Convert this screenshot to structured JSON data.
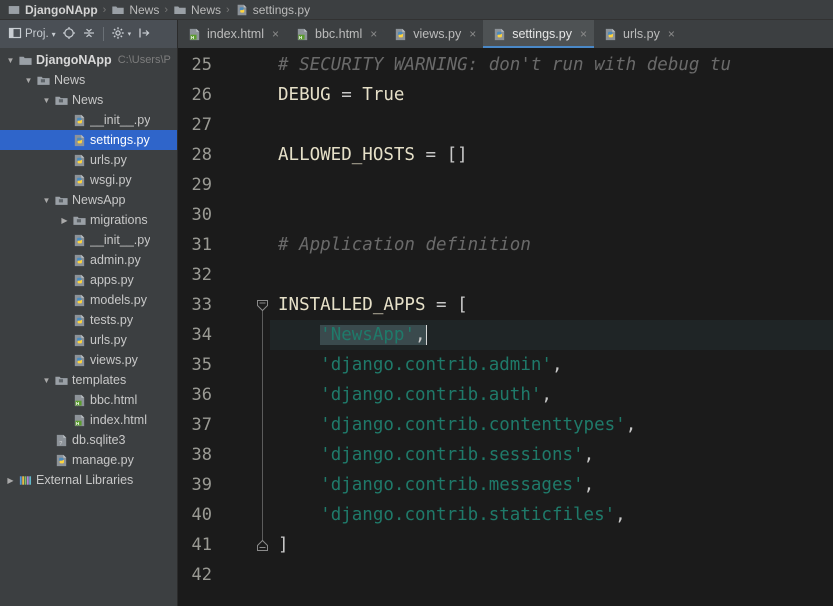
{
  "breadcrumb": {
    "items": [
      {
        "label": "DjangoNApp",
        "icon": "project-icon",
        "bold": true
      },
      {
        "label": "News",
        "icon": "folder-icon",
        "bold": false
      },
      {
        "label": "News",
        "icon": "folder-icon",
        "bold": false
      },
      {
        "label": "settings.py",
        "icon": "python-file-icon",
        "bold": false
      }
    ],
    "separator": "›"
  },
  "toolbar": {
    "project_label": "Proj.",
    "project_dropdown": "▾",
    "locate_icon": "target-icon",
    "collapse_icon": "collapse-all-icon",
    "settings_icon": "gear-icon",
    "settings_dropdown": "▾",
    "hide_icon": "hide-panel-icon"
  },
  "tabs": [
    {
      "label": "index.html",
      "icon": "html-file-icon",
      "active": false,
      "close": "×"
    },
    {
      "label": "bbc.html",
      "icon": "html-file-icon",
      "active": false,
      "close": "×"
    },
    {
      "label": "views.py",
      "icon": "python-file-icon",
      "active": false,
      "close": "×"
    },
    {
      "label": "settings.py",
      "icon": "python-file-icon",
      "active": true,
      "close": "×"
    },
    {
      "label": "urls.py",
      "icon": "python-file-icon",
      "active": false,
      "close": "×"
    }
  ],
  "tree": [
    {
      "label": "DjangoNApp",
      "path": "C:\\Users\\P",
      "indent": 0,
      "arrow": "down",
      "icon": "folder-icon",
      "bold": true,
      "selected": false
    },
    {
      "label": "News",
      "indent": 1,
      "arrow": "down",
      "icon": "module-folder-icon",
      "bold": false,
      "selected": false
    },
    {
      "label": "News",
      "indent": 2,
      "arrow": "down",
      "icon": "module-folder-icon",
      "bold": false,
      "selected": false
    },
    {
      "label": "__init__.py",
      "indent": 3,
      "arrow": "none",
      "icon": "python-file-icon",
      "bold": false,
      "selected": false
    },
    {
      "label": "settings.py",
      "indent": 3,
      "arrow": "none",
      "icon": "python-file-icon",
      "bold": false,
      "selected": true
    },
    {
      "label": "urls.py",
      "indent": 3,
      "arrow": "none",
      "icon": "python-file-icon",
      "bold": false,
      "selected": false
    },
    {
      "label": "wsgi.py",
      "indent": 3,
      "arrow": "none",
      "icon": "python-file-icon",
      "bold": false,
      "selected": false
    },
    {
      "label": "NewsApp",
      "indent": 2,
      "arrow": "down",
      "icon": "module-folder-icon",
      "bold": false,
      "selected": false
    },
    {
      "label": "migrations",
      "indent": 3,
      "arrow": "right",
      "icon": "module-folder-icon",
      "bold": false,
      "selected": false
    },
    {
      "label": "__init__.py",
      "indent": 3,
      "arrow": "none",
      "icon": "python-file-icon",
      "bold": false,
      "selected": false
    },
    {
      "label": "admin.py",
      "indent": 3,
      "arrow": "none",
      "icon": "python-file-icon",
      "bold": false,
      "selected": false
    },
    {
      "label": "apps.py",
      "indent": 3,
      "arrow": "none",
      "icon": "python-file-icon",
      "bold": false,
      "selected": false
    },
    {
      "label": "models.py",
      "indent": 3,
      "arrow": "none",
      "icon": "python-file-icon",
      "bold": false,
      "selected": false
    },
    {
      "label": "tests.py",
      "indent": 3,
      "arrow": "none",
      "icon": "python-file-icon",
      "bold": false,
      "selected": false
    },
    {
      "label": "urls.py",
      "indent": 3,
      "arrow": "none",
      "icon": "python-file-icon",
      "bold": false,
      "selected": false
    },
    {
      "label": "views.py",
      "indent": 3,
      "arrow": "none",
      "icon": "python-file-icon",
      "bold": false,
      "selected": false
    },
    {
      "label": "templates",
      "indent": 2,
      "arrow": "down",
      "icon": "module-folder-icon",
      "bold": false,
      "selected": false
    },
    {
      "label": "bbc.html",
      "indent": 3,
      "arrow": "none",
      "icon": "html-file-icon",
      "bold": false,
      "selected": false
    },
    {
      "label": "index.html",
      "indent": 3,
      "arrow": "none",
      "icon": "html-file-icon",
      "bold": false,
      "selected": false
    },
    {
      "label": "db.sqlite3",
      "indent": 2,
      "arrow": "none",
      "icon": "db-file-icon",
      "bold": false,
      "selected": false
    },
    {
      "label": "manage.py",
      "indent": 2,
      "arrow": "none",
      "icon": "python-file-icon",
      "bold": false,
      "selected": false
    },
    {
      "label": "External Libraries",
      "indent": 0,
      "arrow": "right",
      "icon": "libraries-icon",
      "bold": false,
      "selected": false
    }
  ],
  "editor": {
    "file": "settings.py",
    "first_visible_line": 25,
    "selected_line": 34,
    "lines": [
      {
        "num": 25,
        "tokens": [
          {
            "text": "# SECURITY WARNING: don't run with debug tu",
            "type": "comment"
          }
        ]
      },
      {
        "num": 26,
        "tokens": [
          {
            "text": "DEBUG",
            "type": "ident"
          },
          {
            "text": " = ",
            "type": "op"
          },
          {
            "text": "True",
            "type": "kw"
          }
        ]
      },
      {
        "num": 27,
        "tokens": []
      },
      {
        "num": 28,
        "tokens": [
          {
            "text": "ALLOWED_HOSTS",
            "type": "ident"
          },
          {
            "text": " = ",
            "type": "op"
          },
          {
            "text": "[]",
            "type": "punct"
          }
        ]
      },
      {
        "num": 29,
        "tokens": []
      },
      {
        "num": 30,
        "tokens": []
      },
      {
        "num": 31,
        "tokens": [
          {
            "text": "# Application definition",
            "type": "comment"
          }
        ]
      },
      {
        "num": 32,
        "tokens": []
      },
      {
        "num": 33,
        "tokens": [
          {
            "text": "INSTALLED_APPS",
            "type": "ident"
          },
          {
            "text": " = ",
            "type": "op"
          },
          {
            "text": "[",
            "type": "punct"
          }
        ]
      },
      {
        "num": 34,
        "tokens": [
          {
            "text": "    ",
            "type": "punct"
          },
          {
            "text": "'NewsApp'",
            "type": "str",
            "selected": true
          },
          {
            "text": ",",
            "type": "punct",
            "selected": true
          }
        ]
      },
      {
        "num": 35,
        "tokens": [
          {
            "text": "    ",
            "type": "punct"
          },
          {
            "text": "'django.contrib.admin'",
            "type": "str"
          },
          {
            "text": ",",
            "type": "punct"
          }
        ]
      },
      {
        "num": 36,
        "tokens": [
          {
            "text": "    ",
            "type": "punct"
          },
          {
            "text": "'django.contrib.auth'",
            "type": "str"
          },
          {
            "text": ",",
            "type": "punct"
          }
        ]
      },
      {
        "num": 37,
        "tokens": [
          {
            "text": "    ",
            "type": "punct"
          },
          {
            "text": "'django.contrib.contenttypes'",
            "type": "str"
          },
          {
            "text": ",",
            "type": "punct"
          }
        ]
      },
      {
        "num": 38,
        "tokens": [
          {
            "text": "    ",
            "type": "punct"
          },
          {
            "text": "'django.contrib.sessions'",
            "type": "str"
          },
          {
            "text": ",",
            "type": "punct"
          }
        ]
      },
      {
        "num": 39,
        "tokens": [
          {
            "text": "    ",
            "type": "punct"
          },
          {
            "text": "'django.contrib.messages'",
            "type": "str"
          },
          {
            "text": ",",
            "type": "punct"
          }
        ]
      },
      {
        "num": 40,
        "tokens": [
          {
            "text": "    ",
            "type": "punct"
          },
          {
            "text": "'django.contrib.staticfiles'",
            "type": "str"
          },
          {
            "text": ",",
            "type": "punct"
          }
        ]
      },
      {
        "num": 41,
        "tokens": [
          {
            "text": "]",
            "type": "punct"
          }
        ]
      },
      {
        "num": 42,
        "tokens": []
      }
    ],
    "gutter_icons": [
      {
        "line": 33,
        "icon": "fold-expanded-icon"
      },
      {
        "line": 34,
        "icon": "intention-bulb-icon"
      },
      {
        "line": 41,
        "icon": "fold-end-icon"
      }
    ]
  },
  "colors": {
    "window_bg": "#3c3f41",
    "editor_bg": "#1b1b1b",
    "tree_selection": "#2f65ca",
    "tab_active_underline": "#4a88c7",
    "string_green": "#1f7a6a",
    "identifier": "#e6e0c8",
    "comment_gray": "#6a6a6a",
    "line_number": "#9a9a94"
  }
}
